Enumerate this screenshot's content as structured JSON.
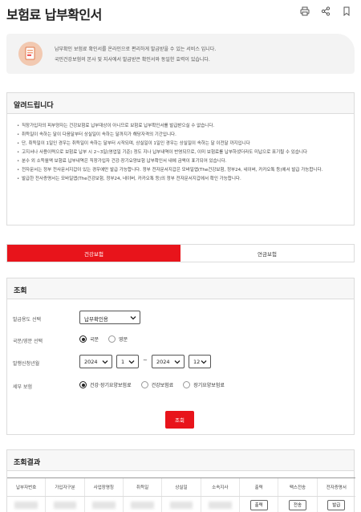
{
  "header": {
    "title": "보험료 납부확인서",
    "icons": [
      "print-icon",
      "share-icon",
      "bookmark-icon"
    ]
  },
  "intro": {
    "line1": "납부확인 보험료 확인서를 온라인으로 편리하게 발급받을 수 있는 서비스 입니다.",
    "line2": "국민건강보험의 본사 및 지사에서 발급받은 확인서와 동일한 효력이 있습니다."
  },
  "notice": {
    "title": "알려드립니다",
    "items": [
      "직장가입자의 피부양자는 건강보험료 납부대상이 아니므로 보험료 납부확인서를 발급받으실 수 없습니다.",
      "취득일이 속하는 달이 다음달부터 상실일이 속하는 달까지가 해당자격의 기간입니다.",
      "단, 취득일이 1일인 경우는 취득일이 속하는 달부터 시작되며, 상실일이 1일인 경우는 상실일이 속하는 달 이전달 까지입니다",
      "고지서나 사용이력으로 보험료 납부 시 2~3일(영업일 기준) 정도 지나 납부내역이 반영되므로, 이미 보험료를 납부하셨더라도 미납으로 표기될 수 있습니다",
      "분수 외 소득월액 보험료 납부내역은 직장가입자 건강·장기요양보험 납부확인서 내에 금액이 표기되어 있습니다.",
      "전자문서는 정부 전사문서지갑이 있는 경우에만 발급 가능합니다. 정부 전자문서지갑은 모바일앱(The건강보험, 정부24, 네이버, 카카오톡 등)에서 발급 가능합니다.",
      "발급한 전사증명서는 모바일앱(The건강보험, 정부24, 네이버, 카카오톡 등)의 정부 전자문서지갑에서 확인 가능합니다."
    ]
  },
  "tabs": [
    {
      "label": "건강보험",
      "active": true
    },
    {
      "label": "연금보험",
      "active": false
    }
  ],
  "search": {
    "title": "조회",
    "purpose": {
      "label": "발급용도 선택",
      "value": "납부확인용"
    },
    "language": {
      "label": "국문/영문 선택",
      "options": [
        "국문",
        "영문"
      ],
      "selected": "국문"
    },
    "period": {
      "label": "발행신청년월",
      "start_year": "2024",
      "start_month": "1",
      "end_year": "2024",
      "end_month": "12",
      "separator": "~"
    },
    "detail": {
      "label": "세부 보험",
      "options": [
        "건강·장기요양보험료",
        "건강보험료",
        "장기요양보험료"
      ],
      "selected": "건강·장기요양보험료"
    },
    "submit_label": "조회"
  },
  "results": {
    "title": "조회결과",
    "columns": [
      "납부자번호",
      "가입자구분",
      "사업장명칭",
      "취득일",
      "상실일",
      "소속지사",
      "출력",
      "팩스전송",
      "전자증명서"
    ],
    "row_buttons": [
      "출력",
      "전송",
      "발급"
    ]
  }
}
